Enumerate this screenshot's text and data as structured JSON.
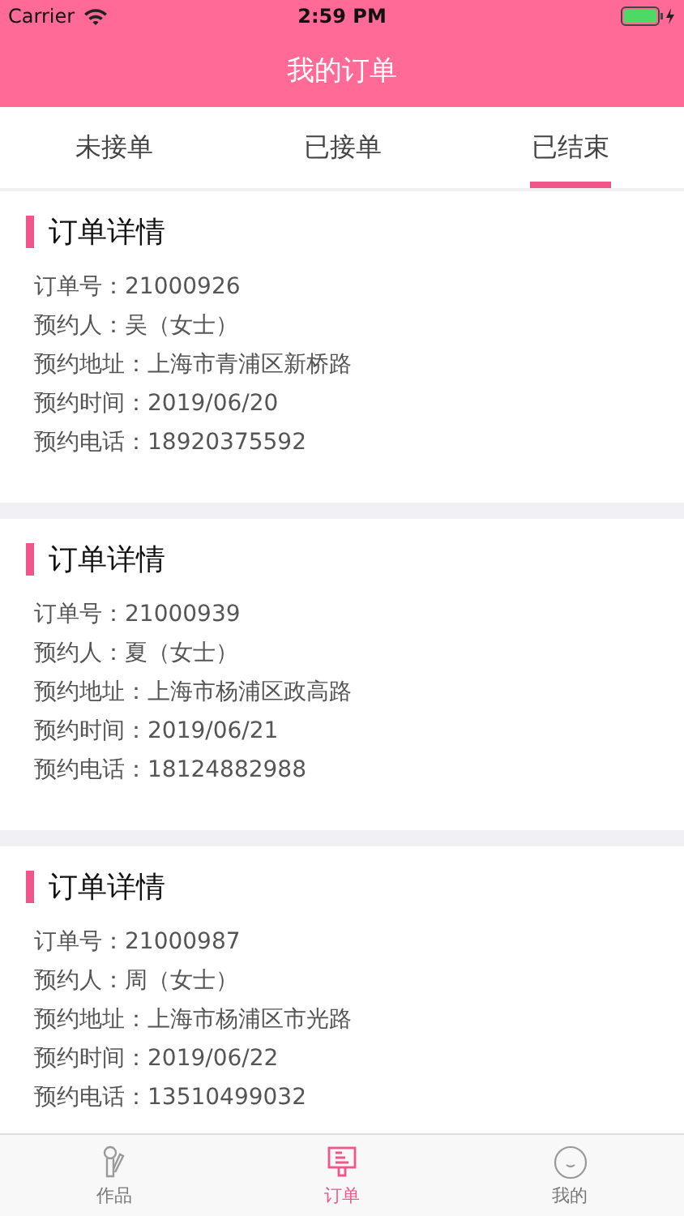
{
  "status_bar": {
    "carrier": "Carrier",
    "time": "2:59 PM"
  },
  "header": {
    "title": "我的订单"
  },
  "tabs": [
    {
      "label": "未接单",
      "selected": false
    },
    {
      "label": "已接单",
      "selected": false
    },
    {
      "label": "已结束",
      "selected": true
    }
  ],
  "orders": [
    {
      "title": "订单详情",
      "fields": [
        {
          "label": "订单号：",
          "value": "21000926"
        },
        {
          "label": "预约人：",
          "value": "吴（女士）"
        },
        {
          "label": "预约地址：",
          "value": "上海市青浦区新桥路"
        },
        {
          "label": "预约时间：",
          "value": "2019/06/20"
        },
        {
          "label": "预约电话：",
          "value": "18920375592"
        }
      ]
    },
    {
      "title": "订单详情",
      "fields": [
        {
          "label": "订单号：",
          "value": "21000939"
        },
        {
          "label": "预约人：",
          "value": "夏（女士）"
        },
        {
          "label": "预约地址：",
          "value": "上海市杨浦区政高路"
        },
        {
          "label": "预约时间：",
          "value": "2019/06/21"
        },
        {
          "label": "预约电话：",
          "value": "18124882988"
        }
      ]
    },
    {
      "title": "订单详情",
      "fields": [
        {
          "label": "订单号：",
          "value": "21000987"
        },
        {
          "label": "预约人：",
          "value": "周（女士）"
        },
        {
          "label": "预约地址：",
          "value": "上海市杨浦区市光路"
        },
        {
          "label": "预约时间：",
          "value": "2019/06/22"
        },
        {
          "label": "预约电话：",
          "value": "13510499032"
        }
      ]
    }
  ],
  "tab_bar": [
    {
      "kind": "works",
      "label": "作品",
      "selected": false
    },
    {
      "kind": "orders",
      "label": "订单",
      "selected": true
    },
    {
      "kind": "me",
      "label": "我的",
      "selected": false
    }
  ]
}
